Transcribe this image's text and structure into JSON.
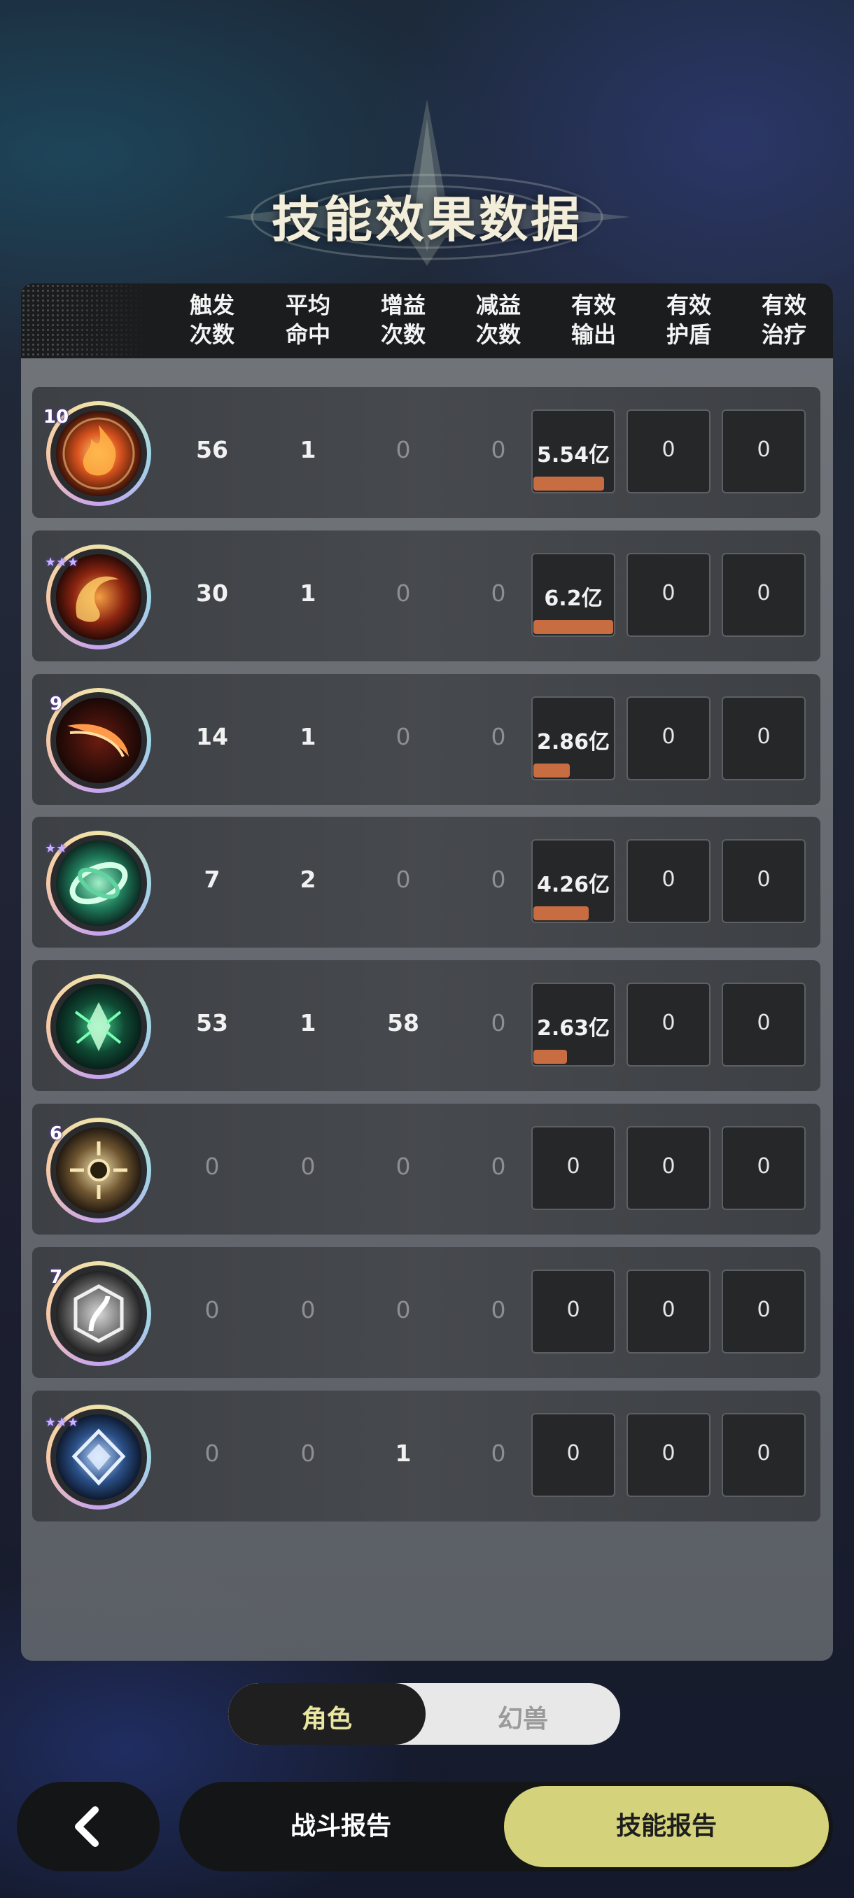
{
  "title": "技能效果数据",
  "headers": [
    [
      "触发",
      "次数"
    ],
    [
      "平均",
      "命中"
    ],
    [
      "增益",
      "次数"
    ],
    [
      "减益",
      "次数"
    ],
    [
      "有效",
      "输出"
    ],
    [
      "有效",
      "护盾"
    ],
    [
      "有效",
      "治疗"
    ]
  ],
  "rows": [
    {
      "icon": "fire-orb-icon",
      "badge": "10",
      "stars": "",
      "trigger": "56",
      "hit": "1",
      "buff": "0",
      "debuff": "0",
      "output": "5.54亿",
      "output_pct": 0.89,
      "shield": "0",
      "heal": "0"
    },
    {
      "icon": "fire-swirl-icon",
      "badge": "",
      "stars": "★★★",
      "trigger": "30",
      "hit": "1",
      "buff": "0",
      "debuff": "0",
      "output": "6.2亿",
      "output_pct": 1.0,
      "shield": "0",
      "heal": "0"
    },
    {
      "icon": "fire-slash-icon",
      "badge": "9",
      "stars": "",
      "trigger": "14",
      "hit": "1",
      "buff": "0",
      "debuff": "0",
      "output": "2.86亿",
      "output_pct": 0.46,
      "shield": "0",
      "heal": "0"
    },
    {
      "icon": "jade-rings-icon",
      "badge": "",
      "stars": "★★",
      "trigger": "7",
      "hit": "2",
      "buff": "0",
      "debuff": "0",
      "output": "4.26亿",
      "output_pct": 0.69,
      "shield": "0",
      "heal": "0"
    },
    {
      "icon": "green-crystal-icon",
      "badge": "",
      "stars": "",
      "trigger": "53",
      "hit": "1",
      "buff": "58",
      "debuff": "0",
      "output": "2.63亿",
      "output_pct": 0.42,
      "shield": "0",
      "heal": "0"
    },
    {
      "icon": "golden-vortex-icon",
      "badge": "6",
      "stars": "",
      "trigger": "0",
      "hit": "0",
      "buff": "0",
      "debuff": "0",
      "output": "0",
      "output_pct": 0,
      "shield": "0",
      "heal": "0"
    },
    {
      "icon": "silver-emblem-icon",
      "badge": "7",
      "stars": "",
      "trigger": "0",
      "hit": "0",
      "buff": "0",
      "debuff": "0",
      "output": "0",
      "output_pct": 0,
      "shield": "0",
      "heal": "0"
    },
    {
      "icon": "blue-crest-icon",
      "badge": "",
      "stars": "★★★",
      "trigger": "0",
      "hit": "0",
      "buff": "1",
      "debuff": "0",
      "output": "0",
      "output_pct": 0,
      "shield": "0",
      "heal": "0"
    }
  ],
  "toggle": {
    "active": "角色",
    "inactive": "幻兽"
  },
  "bottom": {
    "back_icon": "chevron-left-icon",
    "battle_report": "战斗报告",
    "skill_report": "技能报告"
  },
  "colors": {
    "output_bar": "#c86c42",
    "active_tab": "#d4d27a",
    "title": "#f3eed9"
  }
}
